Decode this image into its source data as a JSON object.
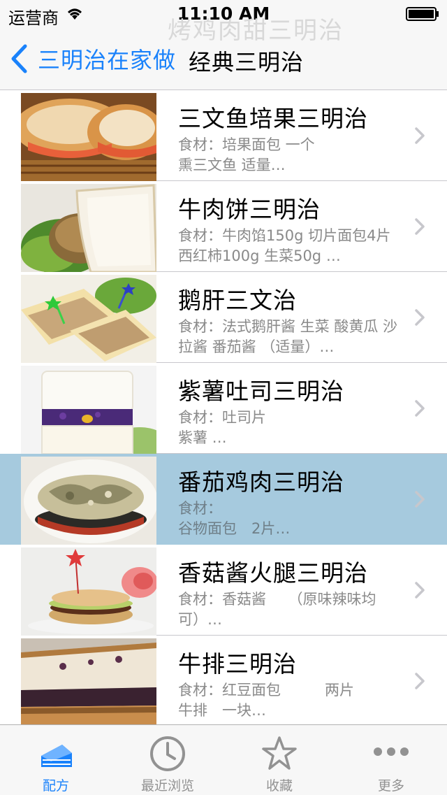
{
  "status_bar": {
    "carrier": "运营商",
    "time": "11:10 AM"
  },
  "nav": {
    "ghost_title": "烤鸡肉甜三明治",
    "back_label": "三明治在家做",
    "title": "经典三明治"
  },
  "recipes": [
    {
      "title": "三文鱼培果三明治",
      "ingredients": "食材：培果面包 一个\n熏三文鱼 适量…",
      "selected": false
    },
    {
      "title": "牛肉饼三明治",
      "ingredients": "食材：牛肉馅150g 切片面包4片 西红柿100g 生菜50g …",
      "selected": false
    },
    {
      "title": "鹅肝三文治",
      "ingredients": "食材：法式鹅肝酱 生菜 酸黄瓜 沙拉酱 番茄酱 （适量）…",
      "selected": false
    },
    {
      "title": "紫薯吐司三明治",
      "ingredients": "食材：吐司片\n紫薯 …",
      "selected": false
    },
    {
      "title": "番茄鸡肉三明治",
      "ingredients": "食材：\n谷物面包　2片…",
      "selected": true
    },
    {
      "title": "香菇酱火腿三明治",
      "ingredients": "食材：香菇酱　　（原味辣味均可）…",
      "selected": false
    },
    {
      "title": "牛排三明治",
      "ingredients": "食材：红豆面包　　　两片\n牛排　一块…",
      "selected": false
    }
  ],
  "tabs": [
    {
      "label": "配方",
      "icon": "cake-icon",
      "active": true
    },
    {
      "label": "最近浏览",
      "icon": "clock-icon",
      "active": false
    },
    {
      "label": "收藏",
      "icon": "star-icon",
      "active": false
    },
    {
      "label": "更多",
      "icon": "more-icon",
      "active": false
    }
  ],
  "colors": {
    "accent": "#1a82fb",
    "selected_row": "#a6cade",
    "bar_background": "#f7f7f7",
    "secondary_text": "#8a8a8a"
  }
}
